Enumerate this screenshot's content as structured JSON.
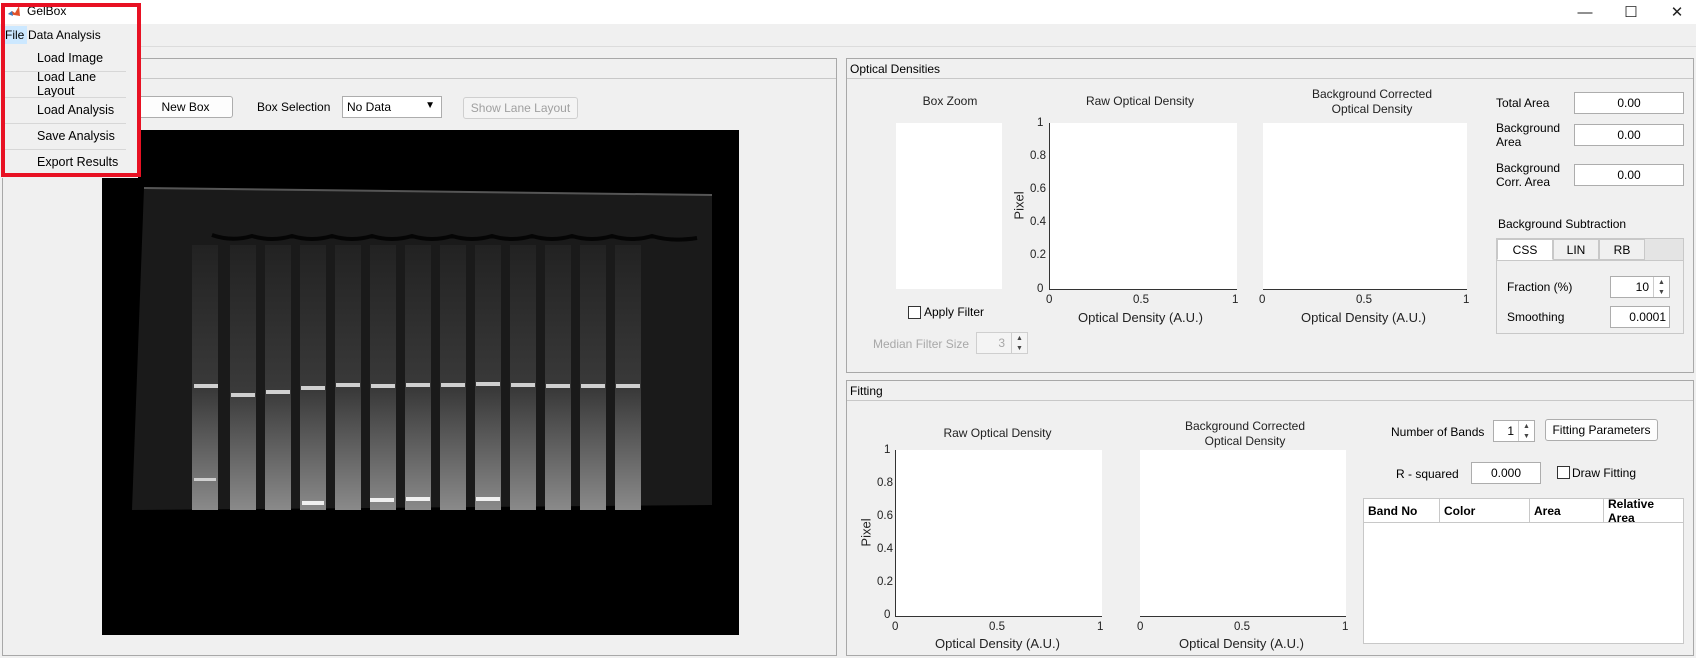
{
  "window": {
    "title": "GelBox",
    "minimize": "—",
    "maximize": "☐",
    "close": "✕"
  },
  "menubar": {
    "file": "File",
    "data_analysis": "Data Analysis"
  },
  "file_menu": [
    "Load Image",
    "Load Lane Layout",
    "Load Analysis",
    "Save Analysis",
    "Export Results"
  ],
  "toolbar": {
    "new_box": "New Box",
    "box_selection_label": "Box Selection",
    "box_selection_value": "No Data",
    "show_lane_layout": "Show Lane Layout"
  },
  "optical_densities": {
    "title": "Optical Densities",
    "box_zoom_title": "Box Zoom",
    "apply_filter": "Apply Filter",
    "median_filter_label": "Median Filter Size",
    "median_filter_value": "3",
    "raw_title": "Raw Optical Density",
    "bg_title_1": "Background Corrected",
    "bg_title_2": "Optical Density",
    "ylabel": "Pixel",
    "xlabel": "Optical Density (A.U.)",
    "yticks": [
      "1",
      "0.8",
      "0.6",
      "0.4",
      "0.2",
      "0"
    ],
    "xticks": [
      "0",
      "0.5",
      "1"
    ],
    "total_area_label": "Total Area",
    "total_area_value": "0.00",
    "background_area_label_1": "Background",
    "background_area_label_2": "Area",
    "background_area_value": "0.00",
    "bg_corr_area_label_1": "Background",
    "bg_corr_area_label_2": "Corr. Area",
    "bg_corr_area_value": "0.00",
    "bg_subtraction_title": "Background Subtraction",
    "tabs": [
      "CSS",
      "LIN",
      "RB"
    ],
    "fraction_label": "Fraction (%)",
    "fraction_value": "10",
    "smoothing_label": "Smoothing",
    "smoothing_value": "0.0001"
  },
  "fitting": {
    "title": "Fitting",
    "raw_title": "Raw Optical Density",
    "bg_title_1": "Background Corrected",
    "bg_title_2": "Optical Density",
    "ylabel": "Pixel",
    "xlabel": "Optical Density (A.U.)",
    "yticks": [
      "1",
      "0.8",
      "0.6",
      "0.4",
      "0.2",
      "0"
    ],
    "xticks": [
      "0",
      "0.5",
      "1"
    ],
    "num_bands_label": "Number of Bands",
    "num_bands_value": "1",
    "fitting_parameters": "Fitting Parameters",
    "r_squared_label": "R - squared",
    "r_squared_value": "0.000",
    "draw_fitting": "Draw Fitting",
    "table_headers": [
      "Band No",
      "Color",
      "Area",
      "Relative Area"
    ]
  },
  "colors": {
    "highlight": "#e81123",
    "menu_selected": "#cce8ff"
  }
}
